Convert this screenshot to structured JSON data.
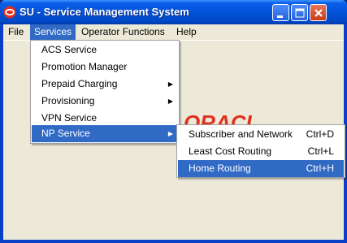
{
  "window": {
    "title": "SU - Service Management System"
  },
  "colors": {
    "title_bar": "#0553d9",
    "menu_highlight": "#316ac5",
    "oracle_red": "#e0301e"
  },
  "menubar": {
    "items": [
      {
        "label": "File"
      },
      {
        "label": "Services"
      },
      {
        "label": "Operator Functions"
      },
      {
        "label": "Help"
      }
    ]
  },
  "services_menu": {
    "items": [
      {
        "label": "ACS Service"
      },
      {
        "label": "Promotion Manager"
      },
      {
        "label": "Prepaid Charging"
      },
      {
        "label": "Provisioning"
      },
      {
        "label": "VPN Service"
      },
      {
        "label": "NP Service"
      }
    ]
  },
  "np_submenu": {
    "items": [
      {
        "label": "Subscriber and Network",
        "shortcut": "Ctrl+D"
      },
      {
        "label": "Least Cost Routing",
        "shortcut": "Ctrl+L"
      },
      {
        "label": "Home Routing",
        "shortcut": "Ctrl+H"
      }
    ]
  },
  "icons": {
    "app": "oracle-logo-icon",
    "minimize": "minimize-icon",
    "maximize": "maximize-icon",
    "close": "close-icon",
    "submenu_arrow": "chevron-right-icon"
  }
}
